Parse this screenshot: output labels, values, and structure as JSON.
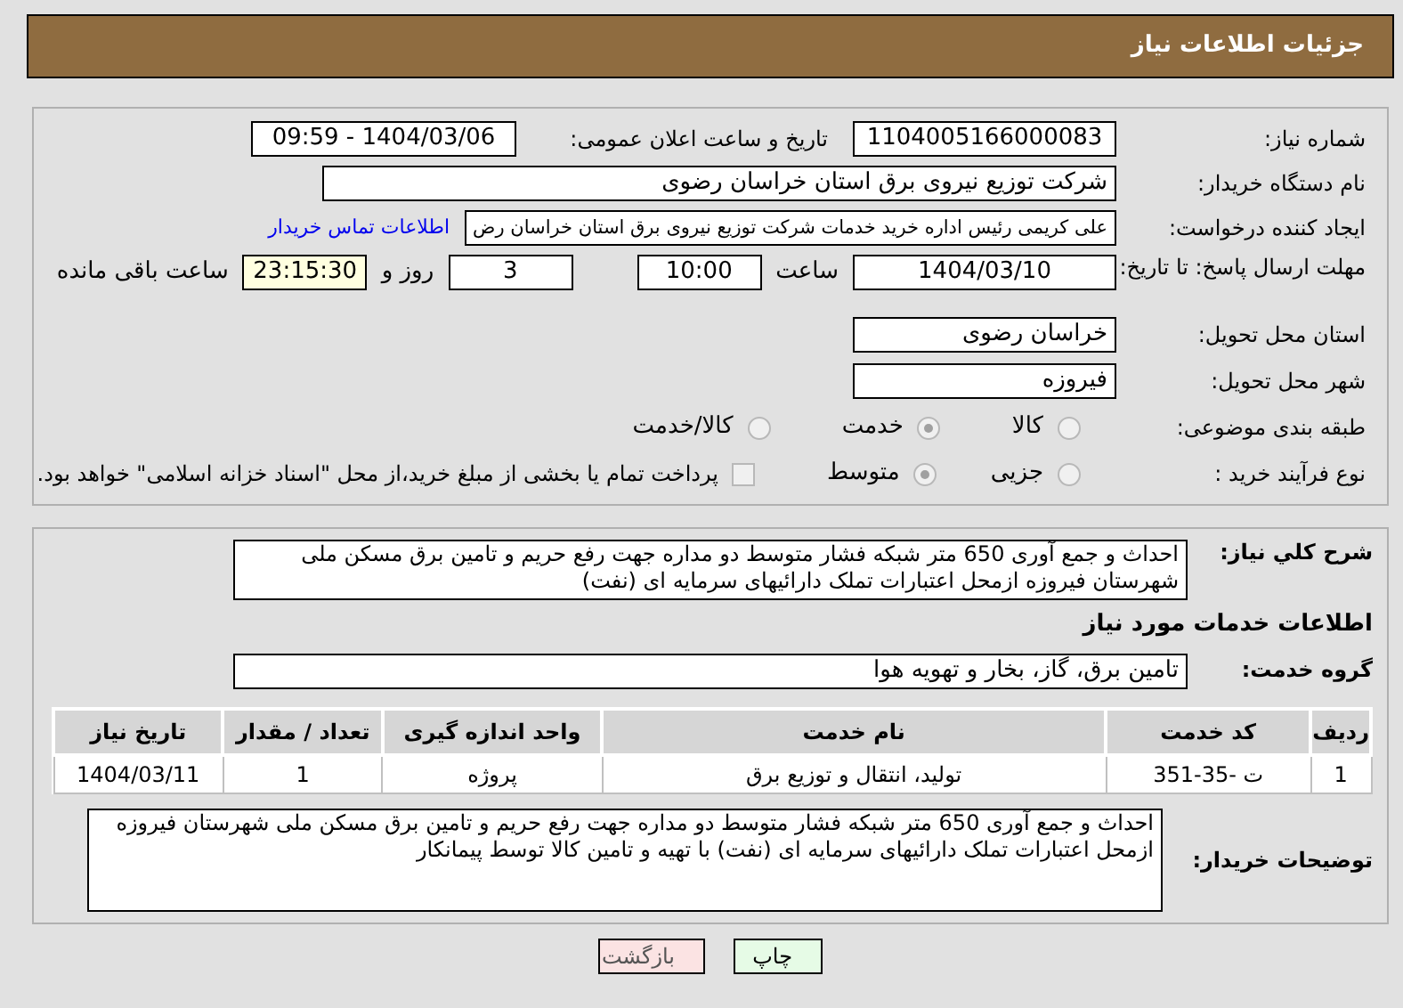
{
  "header": {
    "title": "جزئیات اطلاعات نیاز"
  },
  "details": {
    "need_number": {
      "label": "شماره نیاز:",
      "value": "1104005166000083"
    },
    "announce": {
      "label": "تاریخ و ساعت اعلان عمومی:",
      "value": "1404/03/06 - 09:59"
    },
    "buyer_org": {
      "label": "نام دستگاه خریدار:",
      "value": "شرکت توزیع نیروی برق استان خراسان رضوی"
    },
    "requester": {
      "label": "ایجاد کننده درخواست:",
      "value": "علی کریمی رئیس اداره خرید خدمات شرکت توزیع نیروی برق استان خراسان رض",
      "link": "اطلاعات تماس خریدار"
    },
    "deadline": {
      "label": "مهلت ارسال پاسخ: تا تاریخ:",
      "date": "1404/03/10",
      "time_label": "ساعت",
      "time": "10:00",
      "days": "3",
      "days_label": "روز و",
      "remaining": "23:15:30",
      "remaining_label": "ساعت باقی مانده"
    },
    "province": {
      "label": "استان محل تحویل:",
      "value": "خراسان رضوی"
    },
    "city": {
      "label": "شهر محل تحویل:",
      "value": "فیروزه"
    },
    "category": {
      "label": "طبقه بندی موضوعی:",
      "options": [
        {
          "label": "کالا",
          "selected": false
        },
        {
          "label": "خدمت",
          "selected": true
        },
        {
          "label": "کالا/خدمت",
          "selected": false
        }
      ]
    },
    "process": {
      "label": "نوع فرآیند خرید :",
      "options": [
        {
          "label": "جزیی",
          "selected": false
        },
        {
          "label": "متوسط",
          "selected": true
        }
      ],
      "payment": {
        "label": "پرداخت تمام یا بخشی از مبلغ خرید،از محل \"اسناد خزانه اسلامی\" خواهد بود.",
        "checked": false
      }
    }
  },
  "services": {
    "summary": {
      "label": "شرح کلي نياز:",
      "value": "احداث  و جمع آوری 650 متر شبکه فشار متوسط دو مداره جهت رفع حریم و تامین برق  مسکن ملی شهرستان فیروزه ازمحل اعتبارات تملک دارائیهای سرمایه ای (نفت)"
    },
    "section_title": "اطلاعات خدمات مورد نیاز",
    "group": {
      "label": "گروه خدمت:",
      "value": "تامین برق، گاز، بخار و تهویه هوا"
    },
    "table": {
      "columns": [
        "ردیف",
        "کد خدمت",
        "نام خدمت",
        "واحد اندازه گیری",
        "تعداد / مقدار",
        "تاریخ نیاز"
      ],
      "rows": [
        [
          "1",
          "ت -35-351",
          "تولید، انتقال و توزیع برق",
          "پروژه",
          "1",
          "1404/03/11"
        ]
      ]
    },
    "notes": {
      "label": "توضیحات خریدار:",
      "value": "احداث  و جمع آوری 650 متر شبکه فشار متوسط دو مداره جهت رفع حریم و تامین برق  مسکن ملی شهرستان فیروزه ازمحل اعتبارات تملک دارائیهای سرمایه ای (نفت) با تهیه و تامین کالا توسط پیمانکار"
    }
  },
  "buttons": [
    {
      "label": "چاپ",
      "kind": "print"
    },
    {
      "label": "بازگشت",
      "kind": "back"
    }
  ]
}
